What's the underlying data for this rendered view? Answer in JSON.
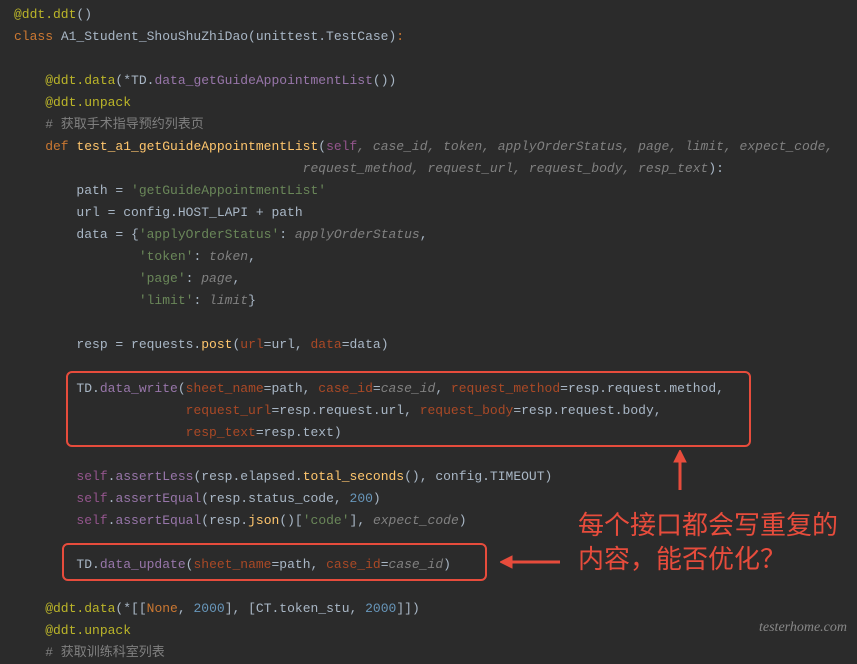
{
  "lines": {
    "l1_decor": "@ddt.ddt",
    "l1_paren": "()",
    "l2_kw": "class ",
    "l2_name": "A1_Student_ShouShuZhiDao",
    "l2_p1": "(unittest.TestCase)",
    "l2_colon": ":",
    "l3_decor": "    @ddt.data",
    "l3_p1": "(*",
    "l3_td": "TD",
    "l3_dot": ".",
    "l3_fn": "data_getGuideAppointmentList",
    "l3_p2": "())",
    "l4_decor": "    @ddt.unpack",
    "l5_cmt": "    # 获取手术指导预约列表页",
    "l6_def": "    def ",
    "l6_fn": "test_a1_getGuideAppointmentList",
    "l6_p1": "(",
    "l6_self": "self",
    "l6_params": ", case_id, token, applyOrderStatus, page, limit, expect_code,",
    "l7_params": "                                     request_method, request_url, request_body, resp_text",
    "l7_p2": "):",
    "l8_pre": "        path = ",
    "l8_str": "'getGuideAppointmentList'",
    "l9_pre": "        url = config.HOST_LAPI + path",
    "l10_pre": "        data = {",
    "l10_k1": "'applyOrderStatus'",
    "l10_c": ": ",
    "l10_v1": "applyOrderStatus",
    "l10_e": ",",
    "l11_pre": "                ",
    "l11_k": "'token'",
    "l11_c": ": ",
    "l11_v": "token",
    "l11_e": ",",
    "l12_pre": "                ",
    "l12_k": "'page'",
    "l12_c": ": ",
    "l12_v": "page",
    "l12_e": ",",
    "l13_pre": "                ",
    "l13_k": "'limit'",
    "l13_c": ": ",
    "l13_v": "limit",
    "l13_e": "}",
    "l14_pre": "        resp = requests.",
    "l14_post": "post",
    "l14_p1": "(",
    "l14_k1": "url",
    "l14_e1": "=url, ",
    "l14_k2": "data",
    "l14_e2": "=data)",
    "l15_pre": "        TD.",
    "l15_fn": "data_write",
    "l15_p1": "(",
    "l15_k1": "sheet_name",
    "l15_e1": "=path, ",
    "l15_k2": "case_id",
    "l15_e2": "=",
    "l15_v2": "case_id",
    "l15_e2b": ", ",
    "l15_k3": "request_method",
    "l15_e3": "=resp.request.method,",
    "l16_pre": "                      ",
    "l16_k1": "request_url",
    "l16_e1": "=resp.request.url, ",
    "l16_k2": "request_body",
    "l16_e2": "=resp.request.body,",
    "l17_pre": "                      ",
    "l17_k1": "resp_text",
    "l17_e1": "=resp.text)",
    "l18_pre": "        ",
    "l18_self": "self",
    "l18_dot": ".",
    "l18_fn": "assertLess",
    "l18_p1": "(resp.elapsed.",
    "l18_fn2": "total_seconds",
    "l18_p2": "(), config.TIMEOUT)",
    "l19_pre": "        ",
    "l19_self": "self",
    "l19_dot": ".",
    "l19_fn": "assertEqual",
    "l19_p1": "(resp.status_code, ",
    "l19_num": "200",
    "l19_p2": ")",
    "l20_pre": "        ",
    "l20_self": "self",
    "l20_dot": ".",
    "l20_fn": "assertEqual",
    "l20_p1": "(resp.",
    "l20_json": "json",
    "l20_p2": "()[",
    "l20_str": "'code'",
    "l20_p3": "], ",
    "l20_v": "expect_code",
    "l20_p4": ")",
    "l21_pre": "        TD.",
    "l21_fn": "data_update",
    "l21_p1": "(",
    "l21_k1": "sheet_name",
    "l21_e1": "=path, ",
    "l21_k2": "case_id",
    "l21_e2": "=",
    "l21_v2": "case_id",
    "l21_p2": ")",
    "l22_decor": "    @ddt.data",
    "l22_p1": "(*[[",
    "l22_none": "None",
    "l22_c1": ", ",
    "l22_n1": "2000",
    "l22_p2": "], [CT.token_stu, ",
    "l22_n2": "2000",
    "l22_p3": "]])",
    "l23_decor": "    @ddt.unpack",
    "l24_cmt": "    # 获取训练科室列表"
  },
  "annotation": {
    "text": "每个接口都会写重复的内容，能否优化？"
  },
  "watermark": "testerhome.com"
}
